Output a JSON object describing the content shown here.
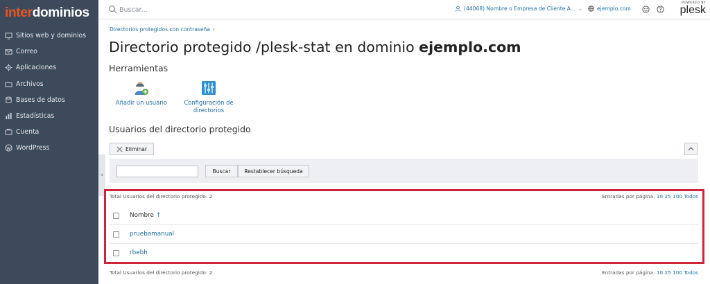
{
  "brand": {
    "logo_part1": "inter",
    "logo_part2": "dominios",
    "accent_color": "#e8571f"
  },
  "sidebar": {
    "items": [
      {
        "label": "Sitios web y dominios",
        "icon": "monitor-icon"
      },
      {
        "label": "Correo",
        "icon": "mail-icon"
      },
      {
        "label": "Aplicaciones",
        "icon": "gear-icon"
      },
      {
        "label": "Archivos",
        "icon": "folder-icon"
      },
      {
        "label": "Bases de datos",
        "icon": "database-icon"
      },
      {
        "label": "Estadísticas",
        "icon": "bar-chart-icon"
      },
      {
        "label": "Cuenta",
        "icon": "account-icon"
      },
      {
        "label": "WordPress",
        "icon": "wordpress-icon"
      }
    ],
    "collapse_glyph": "‹"
  },
  "topbar": {
    "search_placeholder": "Buscar...",
    "account_label": "(44068) Nombre o Empresa de Cliente A...",
    "domain_label": "ejemplo.com",
    "powered_by": "POWERED BY",
    "plesk_label": "plesk"
  },
  "breadcrumb": {
    "item": "Directorios protegidos con contraseña",
    "separator": "›"
  },
  "page": {
    "title_prefix": "Directorio protegido /plesk-stat en dominio ",
    "title_domain": "ejemplo.com"
  },
  "tools": {
    "heading": "Herramientas",
    "items": [
      {
        "label_line1": "Añadir un usuario",
        "label_line2": ""
      },
      {
        "label_line1": "Configuración de",
        "label_line2": "directorios"
      }
    ]
  },
  "users_section": {
    "heading": "Usuarios del directorio protegido",
    "delete_label": "Eliminar",
    "collapse_glyph": "︿",
    "filter_value": "",
    "search_button": "Buscar",
    "reset_button": "Restablecer búsqueda",
    "total_label": "Total Usuarios del directorio protegido: 2",
    "per_page_label": "Entradas por página:",
    "per_page_options": [
      "10",
      "25",
      "100",
      "Todos"
    ],
    "column_name": "Nombre",
    "sort_arrow": "↑",
    "rows": [
      {
        "name": "pruebamanual"
      },
      {
        "name": "rbebh"
      }
    ]
  },
  "colors": {
    "sidebar_bg": "#3d4a5c",
    "link": "#1f6fa3",
    "highlight": "#d0243a"
  }
}
